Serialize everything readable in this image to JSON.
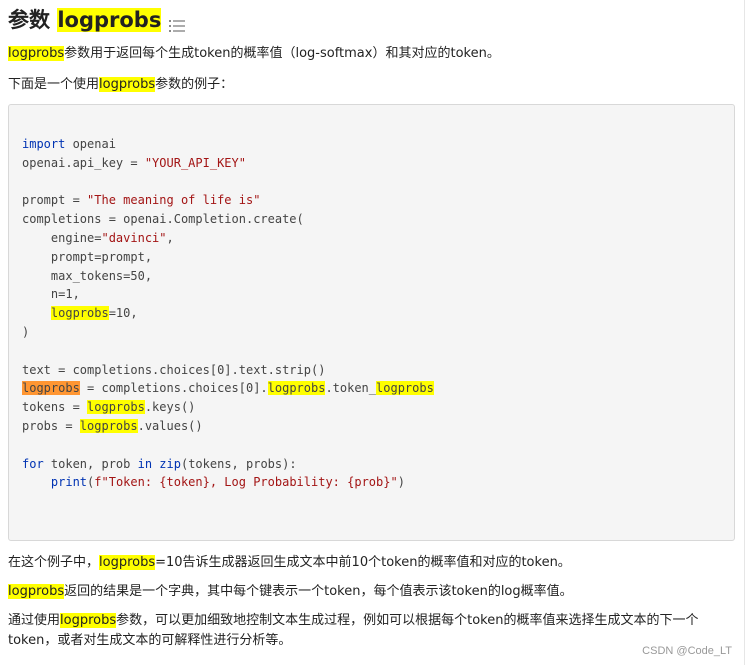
{
  "title": {
    "prefix": "参数 ",
    "highlight": "logprobs"
  },
  "intro": {
    "hl": "logprobs",
    "text": "参数用于返回每个生成token的概率值（log-softmax）和其对应的token。"
  },
  "example_intro": {
    "prefix": "下面是一个使用",
    "hl": "logprobs",
    "suffix": "参数的例子："
  },
  "code": {
    "import_kw": "import",
    "import_mod": " openai",
    "api_key_lhs": "openai.api_key = ",
    "api_key_val": "\"YOUR_API_KEY\"",
    "prompt_lhs": "prompt = ",
    "prompt_val": "\"The meaning of life is\"",
    "completions_line": "completions = openai.Completion.create(",
    "engine_lhs": "    engine=",
    "engine_val": "\"davinci\"",
    "engine_tail": ",",
    "prompt_arg": "    prompt=prompt,",
    "max_tokens": "    max_tokens=50,",
    "n_arg": "    n=1,",
    "logprobs_indent": "    ",
    "logprobs_arg_hl": "logprobs",
    "logprobs_arg_tail": "=10,",
    "close_paren": ")",
    "text_line": "text = completions.choices[0].text.strip()",
    "lp_line_hl1": "logprobs",
    "lp_line_mid1": " = completions.choices[0].",
    "lp_line_hl2": "logprobs",
    "lp_line_mid2": ".token_",
    "lp_line_hl3": "logprobs",
    "tokens_lhs": "tokens = ",
    "tokens_hl": "logprobs",
    "tokens_tail": ".keys()",
    "probs_lhs": "probs = ",
    "probs_hl": "logprobs",
    "probs_tail": ".values()",
    "for_kw": "for",
    "for_mid": " token, prob ",
    "in_kw": "in",
    "zip_fn": "zip",
    "for_tail": "(tokens, probs):",
    "print_indent": "    ",
    "print_fn": "print",
    "print_open": "(",
    "print_str": "f\"Token: {token}, Log Probability: {prob}\"",
    "print_close": ")"
  },
  "para1": {
    "prefix": "在这个例子中，",
    "hl": "logprobs",
    "suffix": "=10告诉生成器返回生成文本中前10个token的概率值和对应的token。"
  },
  "para2": {
    "hl": "logprobs",
    "suffix": "返回的结果是一个字典，其中每个键表示一个token，每个值表示该token的log概率值。"
  },
  "para3": {
    "prefix": "通过使用",
    "hl": "logprobs",
    "line1_suffix": "参数，可以更加细致地控制文本生成过程，例如可以根据每个token的概率值来选择生成文本的下一个",
    "line2": "token，或者对生成文本的可解释性进行分析等。"
  },
  "watermark": "CSDN @Code_LT"
}
